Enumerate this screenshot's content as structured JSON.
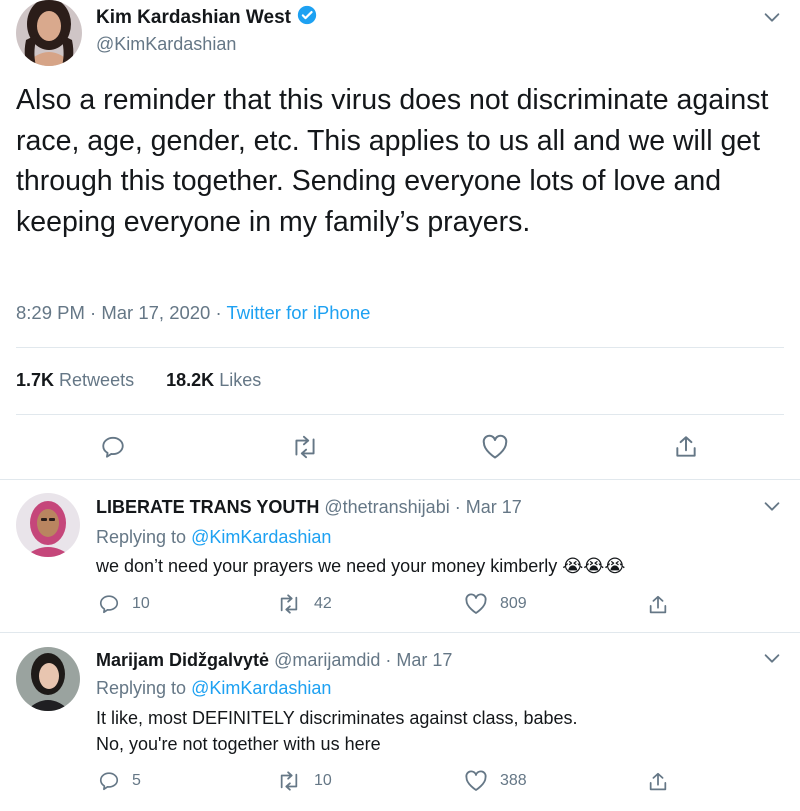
{
  "tweet": {
    "name": "Kim Kardashian West",
    "handle": "@KimKardashian",
    "text": "Also a reminder that this virus does not discriminate against race, age, gender, etc. This applies to us all and we will get through this together. Sending everyone lots of love and keeping everyone in my family’s prayers.",
    "time": "8:29 PM · Mar 17, 2020 · ",
    "source": "Twitter for iPhone",
    "retweets_count": "1.7K",
    "retweets_label": "Retweets",
    "likes_count": "18.2K",
    "likes_label": "Likes"
  },
  "replies": [
    {
      "name": "LIBERATE TRANS YOUTH",
      "handle": "@thetranshijabi",
      "date": "· Mar 17",
      "replying_label": "Replying to",
      "replying_to": "@KimKardashian",
      "text_line1": "we don’t need your prayers we need your money kimberly",
      "emoji": "😭😭😭",
      "reply_count": "10",
      "retweet_count": "42",
      "like_count": "809"
    },
    {
      "name": "Marijam Didžgalvytė",
      "handle": "@marijamdid",
      "date": "· Mar 17",
      "replying_label": "Replying to",
      "replying_to": "@KimKardashian",
      "text_line1": "It like, most DEFINITELY discriminates against class, babes.",
      "text_line2": "No, you're not together with us here",
      "reply_count": "5",
      "retweet_count": "10",
      "like_count": "388"
    }
  ],
  "colors": {
    "accent": "#1da1f2",
    "muted": "#657786",
    "divider": "#e1e8ed"
  }
}
